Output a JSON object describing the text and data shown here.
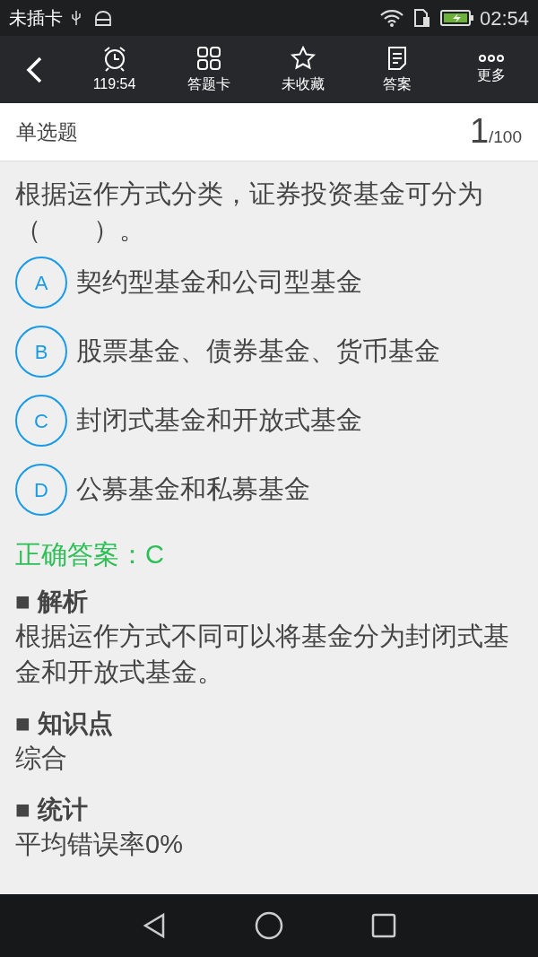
{
  "status_bar": {
    "carrier": "未插卡",
    "time": "02:54"
  },
  "toolbar": {
    "items": [
      {
        "kind": "clock",
        "label": "119:54"
      },
      {
        "kind": "grid",
        "label": "答题卡"
      },
      {
        "kind": "star",
        "label": "未收藏"
      },
      {
        "kind": "doc",
        "label": "答案"
      },
      {
        "kind": "more",
        "label": "更多"
      }
    ]
  },
  "question": {
    "type": "单选题",
    "number": "1",
    "total": "/100",
    "text": "根据运作方式分类，证券投资基金可分为（　　）。",
    "options": [
      {
        "letter": "A",
        "text": "契约型基金和公司型基金",
        "selected": false
      },
      {
        "letter": "B",
        "text": "股票基金、债券基金、货币基金",
        "selected": false
      },
      {
        "letter": "C",
        "text": "封闭式基金和开放式基金",
        "selected": false
      },
      {
        "letter": "D",
        "text": "公募基金和私募基金",
        "selected": false
      }
    ]
  },
  "correct_answer": "正确答案：C",
  "sections": [
    {
      "title": "■ 解析",
      "body": "根据运作方式不同可以将基金分为封闭式基金和开放式基金。"
    },
    {
      "title": "■ 知识点",
      "body": "综合"
    },
    {
      "title": "■ 统计",
      "body": "平均错误率0%"
    }
  ]
}
